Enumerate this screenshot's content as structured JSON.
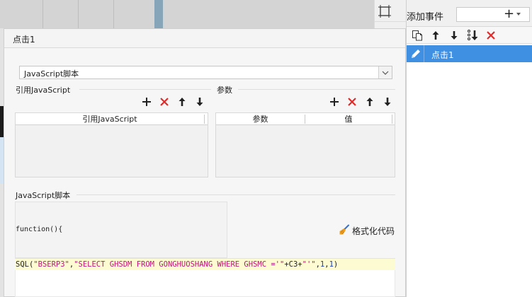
{
  "colors": {
    "accent": "#3f8fe3",
    "delete_red": "#e02b2b",
    "code_highlight": "#fdfbd2",
    "string_magenta": "#c0137a"
  },
  "event_panel": {
    "add_event_label": "添加事件",
    "add_icon": "plus-icon",
    "toolbar_icons": [
      "copy-icon",
      "arrow-up-icon",
      "arrow-down-icon",
      "move-to-bottom-icon",
      "delete-icon"
    ],
    "selected_event": {
      "icon": "pencil-icon",
      "label": "点击1"
    }
  },
  "dialog": {
    "title": "点击1",
    "script_type": {
      "selected": "JavaScript脚本"
    },
    "ref_js": {
      "section_label": "引用JavaScript",
      "toolbar_icons": [
        "plus-icon",
        "delete-icon",
        "arrow-up-icon",
        "arrow-down-icon"
      ],
      "columns": [
        "引用JavaScript"
      ],
      "rows": []
    },
    "params": {
      "section_label": "参数",
      "toolbar_icons": [
        "plus-icon",
        "delete-icon",
        "arrow-up-icon",
        "arrow-down-icon"
      ],
      "columns": [
        "参数",
        "值"
      ],
      "rows": []
    },
    "script": {
      "section_label": "JavaScript脚本",
      "function_header": "function(){",
      "format_button_label": "格式化代码",
      "format_icon": "broom-icon",
      "code_line": {
        "fn": "SQL(",
        "arg1": "\"BSERP3\"",
        "comma1": ",",
        "arg2": "\"SELECT GHSDM FROM GONGHUOSHANG WHERE GHSMC ='\"",
        "concat": "+C3+",
        "arg3": "\"'\"",
        "comma2": ",",
        "num1": "1",
        "comma3": ",",
        "num2": "1",
        "close": ")"
      }
    }
  }
}
